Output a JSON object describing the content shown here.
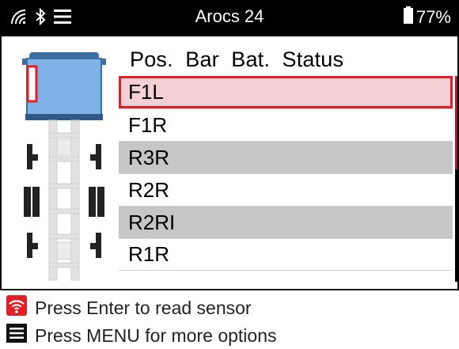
{
  "status_bar": {
    "title": "Arocs 24",
    "battery_percent": "77%",
    "icons": [
      "wifi-icon",
      "bluetooth-icon",
      "menu-icon",
      "battery-icon"
    ]
  },
  "list": {
    "header": "Pos.  Bar  Bat.  Status",
    "rows": [
      "F1L",
      "F1R",
      "R3R",
      "R2R",
      "R2RI",
      "R1R"
    ],
    "selected_index": 0
  },
  "footer": {
    "hint_enter": "Press Enter to read sensor",
    "hint_menu": "Press MENU for more options"
  },
  "colors": {
    "accent_red": "#e21e26",
    "selected_row_bg": "#f4d0d5",
    "alt_row_bg": "#c6c6c6",
    "cab_blue": "#7fb2e6"
  }
}
